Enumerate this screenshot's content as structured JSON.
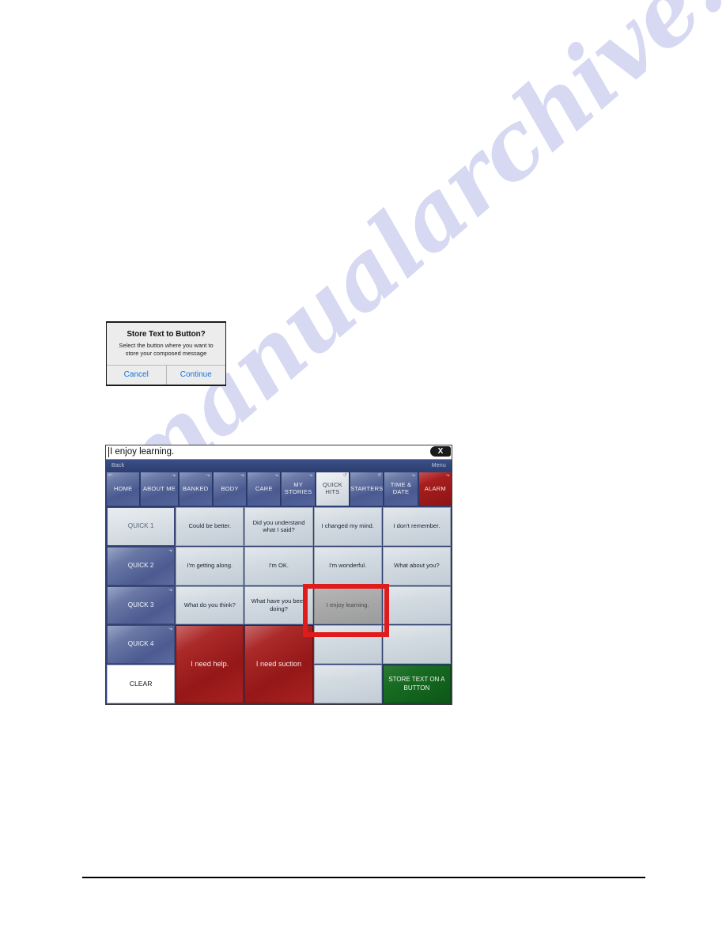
{
  "watermark": {
    "text": "manualarchive.com"
  },
  "dialog": {
    "title": "Store Text to Button?",
    "message": "Select the button where you want to store your composed message",
    "cancel_label": "Cancel",
    "continue_label": "Continue",
    "accent_color": "#1675e0"
  },
  "device": {
    "message_bar": {
      "text": "I enjoy learning.",
      "close_label": "X"
    },
    "toolbar": {
      "back_label": "Back",
      "menu_label": "Menu"
    },
    "nav": {
      "items": [
        {
          "label": "HOME",
          "icon": "back-arrow-icon",
          "state": "normal",
          "style": "home"
        },
        {
          "label": "ABOUT ME",
          "icon": "link-arrow-icon",
          "state": "normal",
          "style": "wide"
        },
        {
          "label": "BANKED",
          "icon": "link-arrow-icon",
          "state": "normal",
          "style": "normal"
        },
        {
          "label": "BODY",
          "icon": "link-arrow-icon",
          "state": "normal",
          "style": "normal"
        },
        {
          "label": "CARE",
          "icon": "link-arrow-icon",
          "state": "normal",
          "style": "normal"
        },
        {
          "label": "MY STORIES",
          "icon": "link-arrow-icon",
          "state": "normal",
          "style": "normal"
        },
        {
          "label": "QUICK HITS",
          "icon": "refresh-icon",
          "state": "active",
          "style": "normal"
        },
        {
          "label": "STARTERS",
          "icon": "refresh-icon",
          "state": "normal",
          "style": "normal"
        },
        {
          "label": "TIME & DATE",
          "icon": "link-arrow-icon",
          "state": "normal",
          "style": "normal"
        },
        {
          "label": "ALARM",
          "icon": "link-arrow-icon",
          "state": "normal",
          "style": "alarm"
        }
      ]
    },
    "grid": {
      "cells": [
        {
          "label": "QUICK 1",
          "kind": "quick-active",
          "icon": ""
        },
        {
          "label": "Could be better.",
          "kind": "text",
          "icon": ""
        },
        {
          "label": "Did you understand what I said?",
          "kind": "text",
          "icon": ""
        },
        {
          "label": "I changed my mind.",
          "kind": "text",
          "icon": ""
        },
        {
          "label": "I don't remember.",
          "kind": "text",
          "icon": ""
        },
        {
          "label": "QUICK 2",
          "kind": "quick",
          "icon": "link-arrow-icon"
        },
        {
          "label": "I'm getting along.",
          "kind": "text",
          "icon": ""
        },
        {
          "label": "I'm OK.",
          "kind": "text",
          "icon": ""
        },
        {
          "label": "I'm wonderful.",
          "kind": "text",
          "icon": ""
        },
        {
          "label": "What about you?",
          "kind": "text",
          "icon": ""
        },
        {
          "label": "QUICK 3",
          "kind": "quick",
          "icon": "link-arrow-icon"
        },
        {
          "label": "What do you think?",
          "kind": "text",
          "icon": ""
        },
        {
          "label": "What have you been doing?",
          "kind": "text",
          "icon": ""
        },
        {
          "label": "I enjoy learning.",
          "kind": "selected",
          "icon": ""
        },
        {
          "label": "",
          "kind": "blank",
          "icon": ""
        },
        {
          "label": "QUICK 4",
          "kind": "quick",
          "icon": "link-arrow-icon"
        },
        {
          "label": "I need help.",
          "kind": "red-span2",
          "icon": ""
        },
        {
          "label": "I need suction",
          "kind": "red-span2",
          "icon": ""
        },
        {
          "label": "",
          "kind": "blank",
          "icon": ""
        },
        {
          "label": "",
          "kind": "blank",
          "icon": ""
        },
        {
          "label": "CLEAR",
          "kind": "clear",
          "icon": ""
        },
        {
          "label": "",
          "kind": "blank",
          "icon": ""
        },
        {
          "label": "STORE TEXT ON A BUTTON",
          "kind": "green",
          "icon": ""
        }
      ]
    }
  },
  "annotation": {
    "color": "#e01b1b",
    "target": "I enjoy learning."
  }
}
